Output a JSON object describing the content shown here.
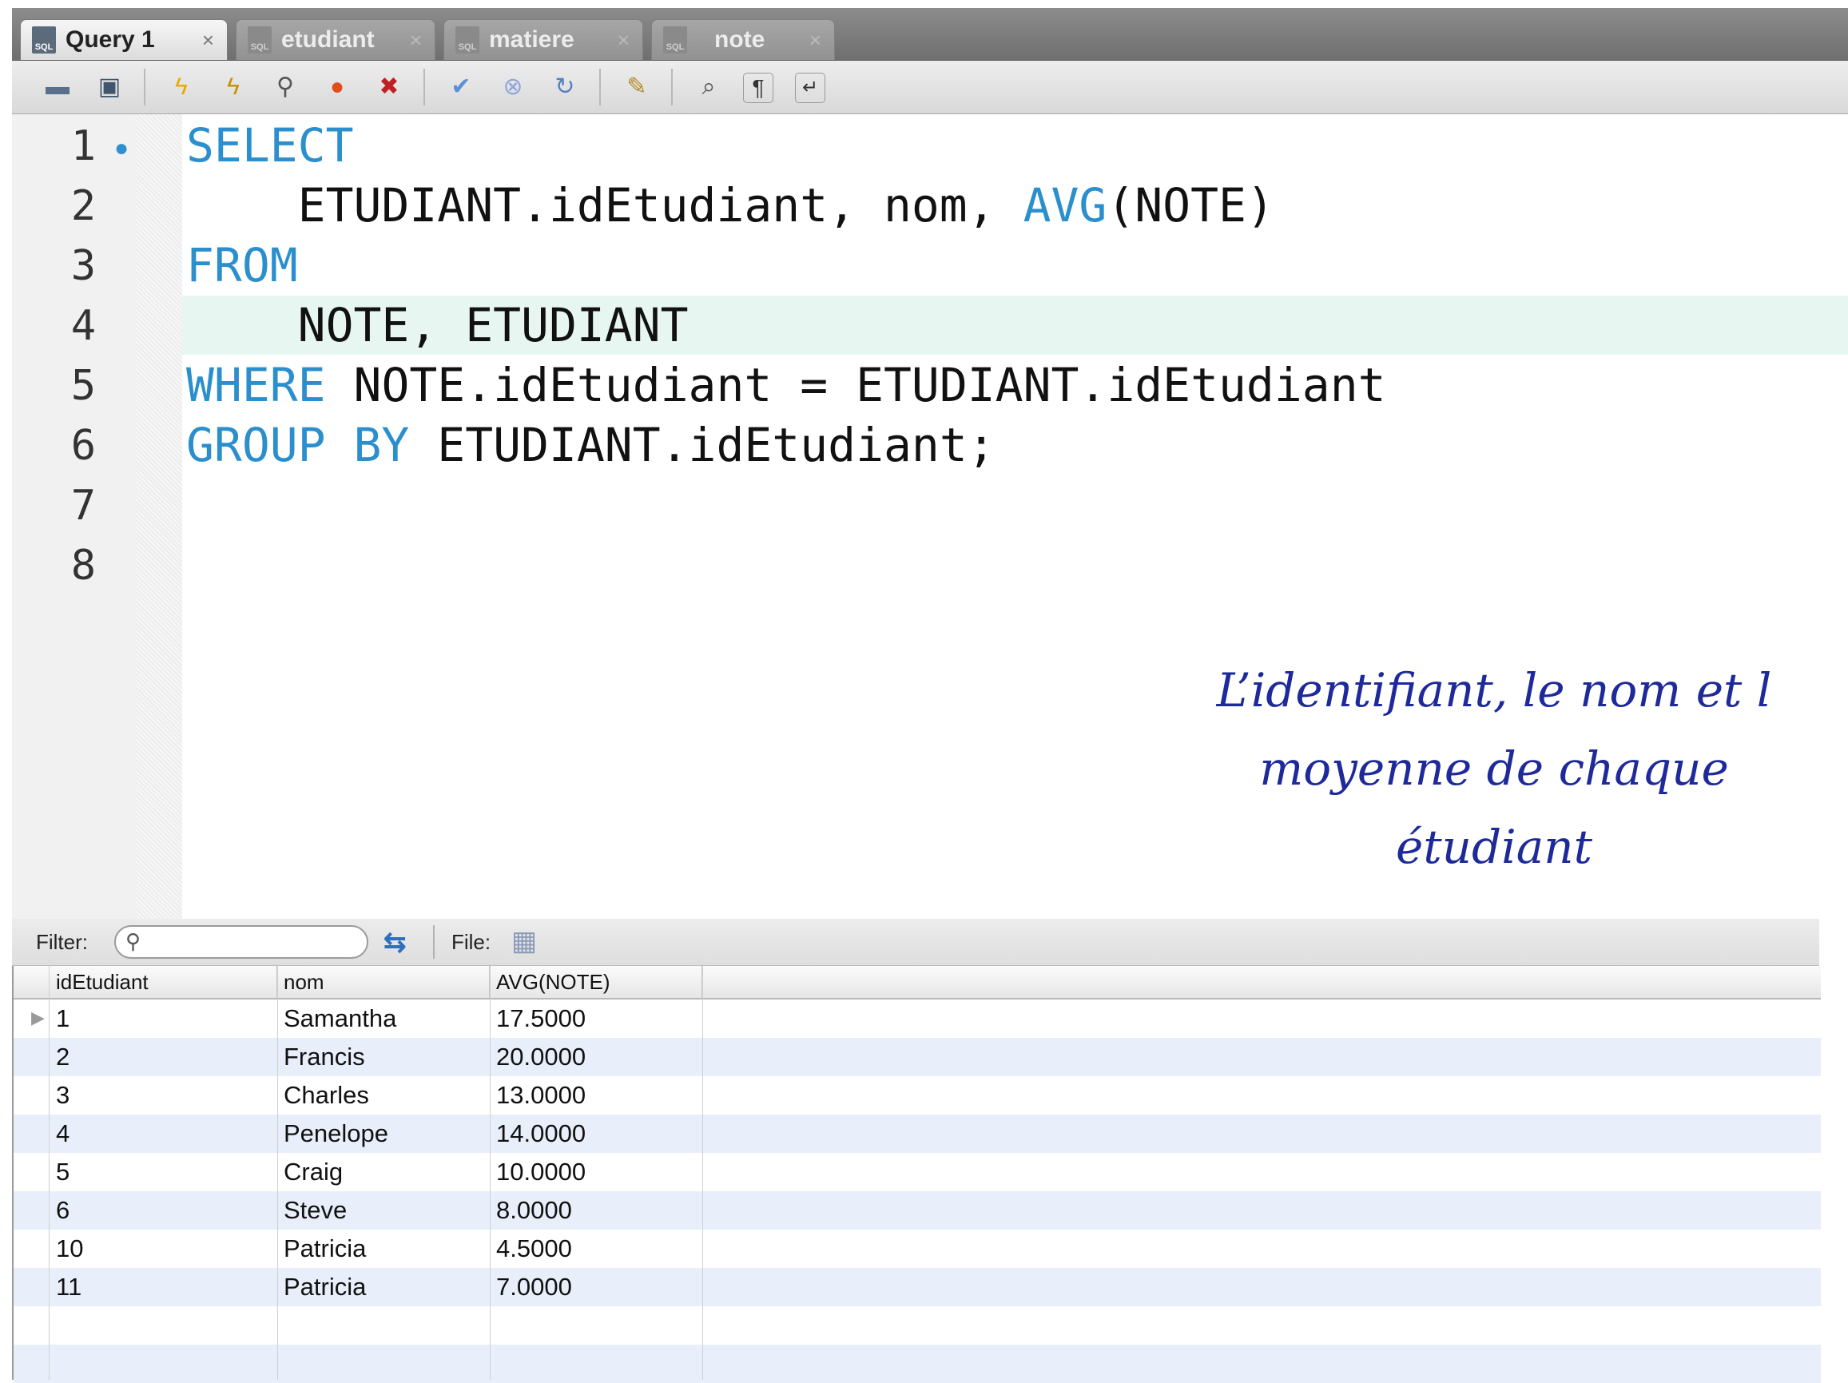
{
  "tabs": [
    {
      "label": "Query 1",
      "icon": "sql-file-icon",
      "active": true
    },
    {
      "label": "etudiant",
      "icon": "sql-file-icon",
      "active": false
    },
    {
      "label": "matiere",
      "icon": "sql-file-icon",
      "active": false
    },
    {
      "label": "note",
      "icon": "sql-file-icon",
      "active": false
    }
  ],
  "toolbar": {
    "icons": [
      "open-folder-icon",
      "save-icon",
      "execute-icon",
      "execute-current-icon",
      "explain-icon",
      "stop-icon",
      "stop-on-error-icon",
      "commit-icon",
      "rollback-icon",
      "autocommit-icon",
      "beautify-icon",
      "find-icon",
      "invisible-chars-icon",
      "word-wrap-icon"
    ]
  },
  "editor": {
    "line_numbers": [
      "1",
      "2",
      "3",
      "4",
      "5",
      "6",
      "7",
      "8"
    ],
    "lines": [
      [
        "SELECT",
        ""
      ],
      [
        "",
        "    ETUDIANT.idEtudiant, nom, ",
        "AVG",
        "(NOTE)"
      ],
      [
        "FROM",
        ""
      ],
      [
        "",
        "    NOTE, ETUDIANT"
      ],
      [
        "WHERE",
        " NOTE.idEtudiant = ETUDIANT.idEtudiant"
      ],
      [
        "GROUP BY",
        " ETUDIANT.idEtudiant;"
      ]
    ],
    "current_line": "4"
  },
  "annotation": "L’identifiant, le nom et l\nmoyenne de chaque\nétudiant",
  "filterbar": {
    "filter_label": "Filter:",
    "filter_value": "",
    "file_label": "File:"
  },
  "results": {
    "columns": [
      "idEtudiant",
      "nom",
      "AVG(NOTE)"
    ],
    "rows": [
      [
        "1",
        "Samantha",
        "17.5000"
      ],
      [
        "2",
        "Francis",
        "20.0000"
      ],
      [
        "3",
        "Charles",
        "13.0000"
      ],
      [
        "4",
        "Penelope",
        "14.0000"
      ],
      [
        "5",
        "Craig",
        "10.0000"
      ],
      [
        "6",
        "Steve",
        "8.0000"
      ],
      [
        "10",
        "Patricia",
        "4.5000"
      ],
      [
        "11",
        "Patricia",
        "7.0000"
      ]
    ]
  }
}
